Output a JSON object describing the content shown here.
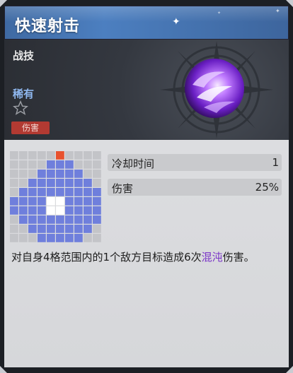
{
  "skill": {
    "name": "快速射击",
    "type": "战技",
    "rarity": "稀有",
    "tag": "伤害",
    "icon": "purple-orb-icon"
  },
  "stats": [
    {
      "label": "冷却时间",
      "value": "1"
    },
    {
      "label": "伤害",
      "value": "25%"
    }
  ],
  "description": {
    "prefix": "对自身4格范围内的1个敌方目标造成6次",
    "highlight": "混沌",
    "suffix": "伤害。"
  },
  "colors": {
    "range": "#6f7fdc",
    "origin": "#ffffff",
    "marker": "#e8522e",
    "empty": "#c3c4c8",
    "highlight": "#7a34c8",
    "tag": "#b23a32"
  },
  "range_grid": [
    "00000E0000",
    "0000RRR000",
    "000RRRRR00",
    "00RRRRRRR0",
    "0RRRRRRRRR",
    "RRRRWWRRRR",
    "RRRRWWRRRR",
    "0RRRRRRRRR",
    "00RRRRRRR0",
    "000RRRRR00"
  ]
}
